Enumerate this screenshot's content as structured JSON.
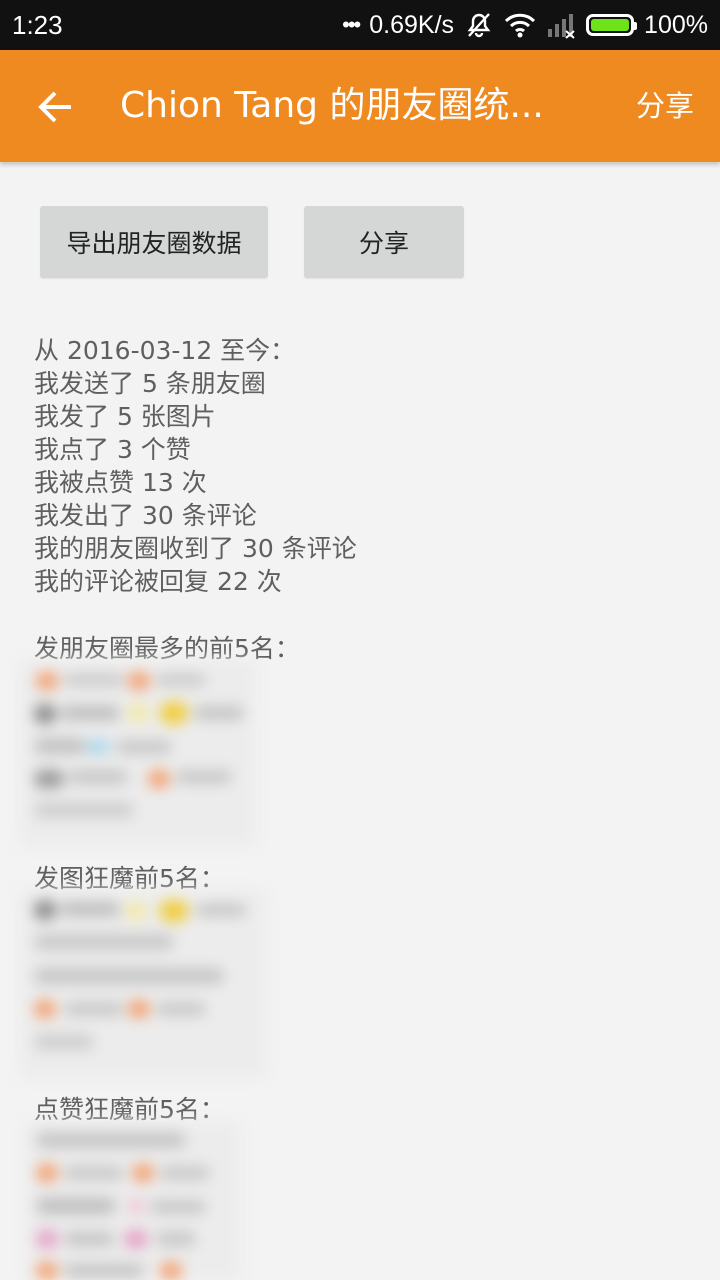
{
  "status_bar": {
    "time": "1:23",
    "dots": "•••",
    "speed": "0.69K/s",
    "battery_percent": "100%",
    "battery_level": 1.0,
    "icons": [
      "mute-icon",
      "wifi-icon",
      "signal-icon",
      "battery-icon"
    ]
  },
  "app_bar": {
    "back_icon": "arrow-back-icon",
    "title": "Chion Tang 的朋友圈统...",
    "share_label": "分享",
    "color": "#ef8a21"
  },
  "buttons": {
    "export_label": "导出朋友圈数据",
    "share_label": "分享"
  },
  "stats": [
    "从 2016-03-12 至今：",
    "我发送了 5 条朋友圈",
    "我发了 5 张图片",
    "我点了 3 个赞",
    "我被点赞 13 次",
    "我发出了 30 条评论",
    "我的朋友圈收到了 30 条评论",
    "我的评论被回复 22 次"
  ],
  "sections": {
    "most_posts_title": "发朋友圈最多的前5名：",
    "most_photos_title": "发图狂魔前5名：",
    "most_likes_title": "点赞狂魔前5名："
  },
  "colors": {
    "background": "#f3f3f3",
    "button_bg": "#d5d7d6",
    "text": "#5f5f5f",
    "status_bar": "#111111",
    "battery_fill": "#6ee31a"
  }
}
